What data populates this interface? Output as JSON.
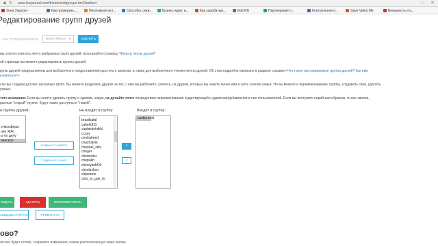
{
  "browser": {
    "url": "www.livejournal.com/friends/editgroups.bml?author=",
    "bookmarks": [
      {
        "label": "Зона Ужасов -",
        "color": "#c0392b"
      },
      {
        "label": "Как проверить ...",
        "color": "#2a79b8"
      },
      {
        "label": "Негативная ист...",
        "color": "#e67e22"
      },
      {
        "label": "Способы сниж...",
        "color": "#2a79b8"
      },
      {
        "label": "Бизнес идеи: в...",
        "color": "#27ae60"
      },
      {
        "label": "Как зарабатыв...",
        "color": "#d35400"
      },
      {
        "label": "Etxt.RU",
        "color": "#2980b9"
      },
      {
        "label": "Партнерские п...",
        "color": "#16a085"
      },
      {
        "label": "Контрольная п...",
        "color": "#8e44ad"
      },
      {
        "label": "Save Video Me",
        "color": "#e74c3c"
      },
      {
        "label": "Внешность и к...",
        "color": "#c0392b"
      }
    ]
  },
  "page": {
    "title": "Редактирование групп друзей",
    "user_label": "АТЬ ПОЛЬЗОВАТЕЛЕМ",
    "user_select": "RICKYTRAKE",
    "change_button": "СМЕНИТЬ",
    "p1": {
      "text": "вы хотите почитать ленту выбранных групп друзей, используйте страницу \"",
      "link": "Фильтр ленты друзей",
      "end": "\""
    },
    "p2": "ой странице вы можете редактировать группы друзей.",
    "p3": {
      "text": "рупы друзей предназначены для выборочного предоставления доступа к записям, а также для выборочного чтения ленты друзей. Об этом подробно написано в разделе справки «",
      "link": "Что такое настраиваемые группы друзей? Как ими"
    },
    "p3b": {
      "link": "ьзоваться?",
      "end": "»"
    },
    "p4": "сли вы создали для вас несколько групп. Вы можете разделить друзей на тех, с кем вы работаете, учитесь, на друзей, которых вы знаете лично или в сети, членов семьи. Но вы можете и переименовывать группы, создавать свои, удалять",
    "p4b": "ужные.",
    "p5": {
      "strong": "тите внимание:",
      "text": " Если вы хотите удалить группу и сделать новую, ",
      "strong2": "не делайте этого",
      "text2": " посредством переименования существующей и удаления/добавления в нее пользователей. Если вы поступите подобным образом, то все записи,"
    },
    "p5b": "ранные \"старой\" группе, будут также доступны и \"новой\"."
  },
  "groups": {
    "title": "и группы друзей:",
    "items": [
      "",
      "",
      "этмосферы",
      "нее ЖЖ",
      "ы по делу",
      "ическое"
    ],
    "selected_index": 5
  },
  "not_in": {
    "title": "Не входят в группу:",
    "items": [
      "brazilsafal",
      "caheik911",
      "captainjeinikki",
      "cccpy",
      "centralreed",
      "chachalnik",
      "channel_sktv",
      "cheger",
      "chemodur",
      "chepukh",
      "chervyachOk",
      "cheslavkon",
      "chipstone",
      "chto_to_gde_to"
    ]
  },
  "in_group": {
    "title": "Входят в группу:",
    "items": [
      "castjournal"
    ]
  },
  "buttons": {
    "move_up": "ПОДВИНУТЬ ВВЕРХ",
    "move_down": "ПОДВИНУТЬ ВНИЗ",
    "add": "»",
    "remove": "«",
    "create": "ОЗДАТЬ",
    "delete": "УДАЛИТЬ",
    "rename": "ПЕРЕИМЕНОВАТЬ",
    "public": "ОБЩЕДОСТУПНАЯ",
    "private": "ПРИВАТНАЯ"
  },
  "footer": {
    "heading": "ово?",
    "note": "ли все будет готово, сохраните изменения, нажав расположенную ниже кнопку."
  },
  "colors": {
    "accent": "#2ea4d8",
    "green": "#3cb878",
    "red": "#d9302c",
    "link": "#2a79b8"
  }
}
